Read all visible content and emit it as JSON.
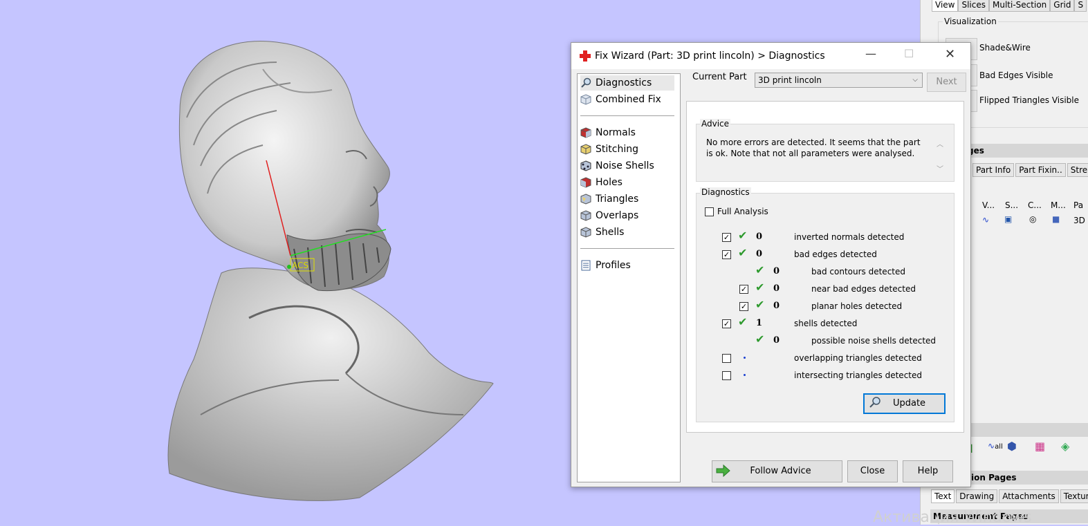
{
  "viewport": {
    "background": "#c5c5ff",
    "acs_label": "ACS"
  },
  "right_panel": {
    "top_tabs": [
      "View",
      "Slices",
      "Multi-Section",
      "Grid",
      "S"
    ],
    "visualization": {
      "title": "Visualization",
      "items": [
        "Shade&Wire",
        "Bad Edges Visible",
        "Flipped Triangles Visible"
      ]
    },
    "pages_header": "ges",
    "part_tabs": [
      "Part Info",
      "Part Fixin..",
      "Stre"
    ],
    "grid_headers": [
      "V...",
      "S...",
      "C...",
      "M...",
      "Pa"
    ],
    "grid_row_last": "3D",
    "action_pages_header": "ion Pages",
    "action_tabs": [
      "Text",
      "Drawing",
      "Attachments",
      "Textur"
    ],
    "measurement_pages_header": "Measurement Pages",
    "icon_all_label": "all"
  },
  "dialog": {
    "title": "Fix Wizard (Part: 3D print lincoln) > Diagnostics",
    "nav_top": [
      {
        "label": "Diagnostics",
        "icon": "magnifier-icon",
        "active": true
      },
      {
        "label": "Combined Fix",
        "icon": "cube-icon",
        "active": false
      }
    ],
    "nav_mid": [
      {
        "label": "Normals",
        "icon": "normals-cube-icon"
      },
      {
        "label": "Stitching",
        "icon": "stitching-cube-icon"
      },
      {
        "label": "Noise Shells",
        "icon": "noise-shells-icon"
      },
      {
        "label": "Holes",
        "icon": "holes-cube-icon"
      },
      {
        "label": "Triangles",
        "icon": "triangles-cube-icon"
      },
      {
        "label": "Overlaps",
        "icon": "overlaps-cube-icon"
      },
      {
        "label": "Shells",
        "icon": "shells-cube-icon"
      }
    ],
    "nav_bottom": [
      {
        "label": "Profiles",
        "icon": "document-icon"
      }
    ],
    "current_part_label": "Current Part",
    "current_part_value": "3D print lincoln",
    "next_label": "Next",
    "advice": {
      "title": "Advice",
      "text": "No more errors are detected. It seems that the part is ok. Note that not all parameters were analysed."
    },
    "diagnostics": {
      "title": "Diagnostics",
      "full_analysis_label": "Full Analysis",
      "full_analysis_checked": false,
      "rows": [
        {
          "checkbox": true,
          "checked": true,
          "status": "ok",
          "count": "0",
          "label": "inverted normals detected",
          "indent": 0
        },
        {
          "checkbox": true,
          "checked": true,
          "status": "ok",
          "count": "0",
          "label": "bad edges detected",
          "indent": 0
        },
        {
          "checkbox": false,
          "checked": false,
          "status": "ok",
          "count": "0",
          "label": "bad contours detected",
          "indent": 1
        },
        {
          "checkbox": true,
          "checked": true,
          "status": "ok",
          "count": "0",
          "label": "near bad edges detected",
          "indent": 1
        },
        {
          "checkbox": true,
          "checked": true,
          "status": "ok",
          "count": "0",
          "label": "planar holes detected",
          "indent": 1
        },
        {
          "checkbox": true,
          "checked": true,
          "status": "ok",
          "count": "1",
          "label": "shells detected",
          "indent": 0
        },
        {
          "checkbox": false,
          "checked": false,
          "status": "ok",
          "count": "0",
          "label": "possible noise shells detected",
          "indent": 1
        },
        {
          "checkbox": true,
          "checked": false,
          "status": "none",
          "count": "",
          "label": "overlapping triangles detected",
          "indent": 0
        },
        {
          "checkbox": true,
          "checked": false,
          "status": "none",
          "count": "",
          "label": "intersecting triangles detected",
          "indent": 0
        }
      ],
      "update_label": "Update"
    },
    "follow_advice_label": "Follow Advice",
    "close_label": "Close",
    "help_label": "Help"
  },
  "colors": {
    "check_green": "#2e9a2e",
    "accent_blue": "#0078d7",
    "cross_red": "#e02020"
  },
  "watermark": "Активация Windows"
}
